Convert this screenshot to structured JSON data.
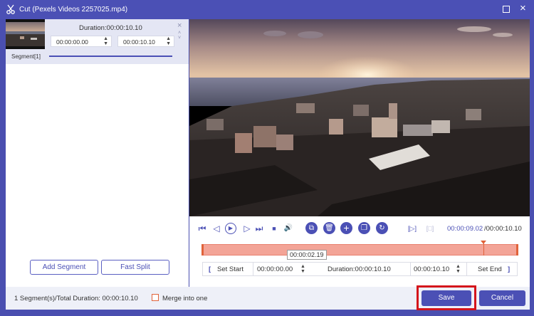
{
  "window": {
    "title": "Cut (Pexels Videos 2257025.mp4)",
    "icon": "scissors-icon",
    "controls": [
      "maximize-icon",
      "close-icon"
    ],
    "close_glyph": "×"
  },
  "segment_panel": {
    "segment": {
      "label": "Segment[1]",
      "duration": "Duration:00:00:10.10",
      "start": "00:00:00.00",
      "end": "00:00:10.10",
      "spin_up": "▲",
      "spin_down": "▼",
      "close_glyph": "×",
      "move_up_glyph": "˄",
      "move_down_glyph": "˅"
    },
    "buttons": {
      "add_segment": "Add Segment",
      "fast_split": "Fast Split"
    }
  },
  "footer": {
    "total": "1 Segment(s)/Total Duration: 00:00:10.10",
    "merge_label": "Merge into one",
    "merge_checked": false,
    "save": "Save",
    "cancel": "Cancel",
    "highlight_color": "#d4141b"
  },
  "player": {
    "current_time": "00:00:09.02",
    "total_time": "/00:00:10.10",
    "controls": [
      "jump-start-icon",
      "prev-frame-icon",
      "play-icon",
      "next-frame-icon",
      "jump-end-icon",
      "stop-icon",
      "volume-icon",
      "copy-icon",
      "delete-icon",
      "add-icon",
      "duplicate-icon",
      "reset-icon",
      "set-start-marker-icon",
      "set-end-marker-icon"
    ],
    "glyphs": {
      "jump_start": "⏮",
      "prev_frame": "◁",
      "play": "▶",
      "next_frame": "▷",
      "jump_end": "⏭",
      "stop": "■",
      "volume": "🔊",
      "copy": "⧉",
      "delete": "🗑",
      "add": "+",
      "duplicate": "❐",
      "reset": "↻",
      "set_start": "[▷]",
      "set_end": "[□]"
    }
  },
  "timeline": {
    "tooltip": "00:00:02.19",
    "playhead_fraction": 0.893
  },
  "edit_row": {
    "set_start": "Set Start",
    "start_value": "00:00:00.00",
    "duration": "Duration:00:00:10.10",
    "end_value": "00:00:10.10",
    "set_end": "Set End",
    "bracket_open": "[",
    "bracket_close": "]",
    "spin_up": "▲",
    "spin_down": "▼"
  },
  "colors": {
    "accent": "#4b50b5",
    "timeline_fill": "#f3a497",
    "timeline_edge": "#e0633a"
  }
}
